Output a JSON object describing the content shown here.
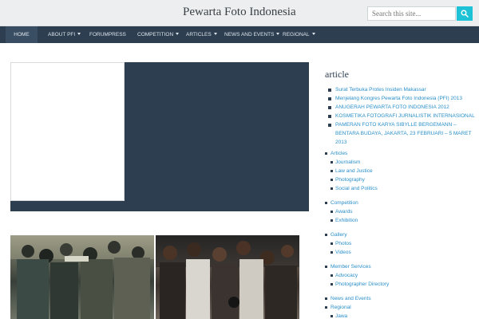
{
  "header": {
    "site_title": "Pewarta Foto Indonesia",
    "search_placeholder": "Search this site...",
    "search_icon": "search-icon"
  },
  "nav": {
    "items": [
      {
        "label": "HOME",
        "active": true,
        "dropdown": false
      },
      {
        "label": "ABOUT PFI",
        "dropdown": true
      },
      {
        "label": "FORUMPRESS",
        "dropdown": false
      },
      {
        "label": "COMPETITION",
        "dropdown": true
      },
      {
        "label": "ARTICLES",
        "dropdown": true
      },
      {
        "label": "NEWS AND EVENTS",
        "dropdown": true
      },
      {
        "label": "REGIONAL",
        "dropdown": true
      }
    ]
  },
  "sidebar": {
    "title": "article",
    "recent_posts": [
      "Surat Terbuka Protes Insiden Makassar",
      "Menjelang Kongres Pewarta Foto Indonesia (PFI) 2013",
      "ANUGERAH PEWARTA FOTO INDONESIA 2012",
      "KOSMETIKA FOTOGRAFI JURNALISTIK INTERNASIONAL",
      "PAMERAN FOTO KARYA SIBYLLE BERGEMANN – BENTARA BUDAYA, JAKARTA, 23 FEBRUARI – 5 MARET 2013"
    ],
    "categories": [
      {
        "label": "Articles",
        "children": [
          "Journalism",
          "Law and Justice",
          "Photography",
          "Social and Politics"
        ]
      },
      {
        "label": "Competition",
        "children": [
          "Awards",
          "Exhibition"
        ]
      },
      {
        "label": "Gallery",
        "children": [
          "Photos",
          "Videos"
        ]
      },
      {
        "label": "Member Services",
        "children": [
          "Advocacy",
          "Photographer Directory"
        ]
      },
      {
        "label": "News and Events",
        "children": []
      },
      {
        "label": "Regional",
        "children": [
          "Jawa"
        ]
      }
    ]
  },
  "colors": {
    "nav_bg": "#2c3e50",
    "accent": "#1ec2d6",
    "link": "#2a8fc9"
  }
}
